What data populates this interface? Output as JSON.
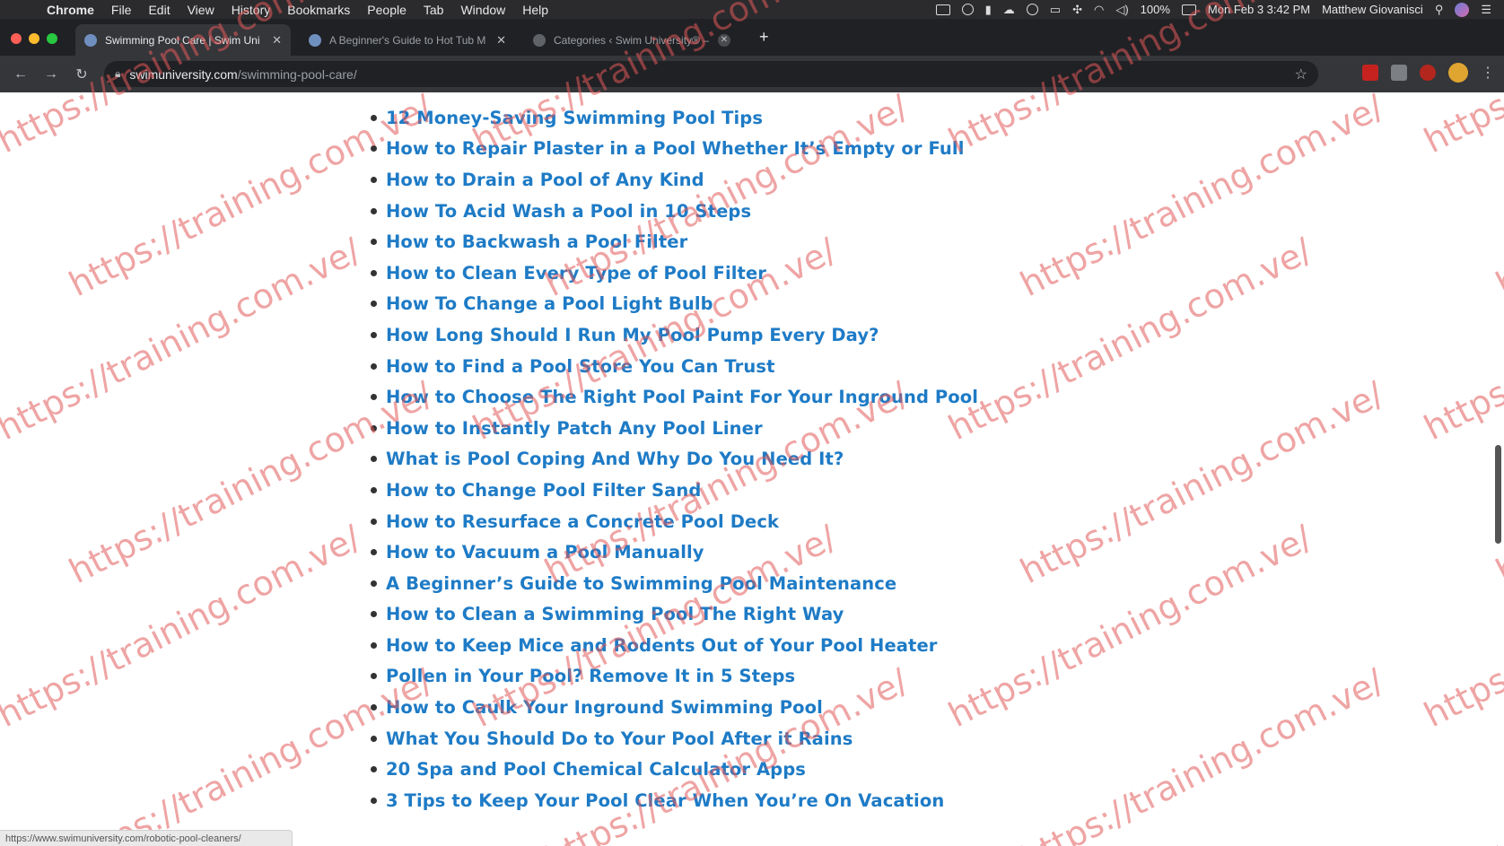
{
  "menubar": {
    "app": "Chrome",
    "items": [
      "File",
      "Edit",
      "View",
      "History",
      "Bookmarks",
      "People",
      "Tab",
      "Window",
      "Help"
    ],
    "battery": "100%",
    "clock": "Mon Feb 3  3:42 PM",
    "user": "Matthew Giovanisci"
  },
  "tabs": [
    {
      "title": "Swimming Pool Care | Swim Uni",
      "active": true
    },
    {
      "title": "A Beginner's Guide to Hot Tub M",
      "active": false
    },
    {
      "title": "Categories ‹ Swim University® –",
      "active": false
    }
  ],
  "toolbar": {
    "url_host": "swimuniversity.com",
    "url_path": "/swimming-pool-care/"
  },
  "articles": [
    "12 Money-Saving Swimming Pool Tips",
    "How to Repair Plaster in a Pool Whether It’s Empty or Full",
    "How to Drain a Pool of Any Kind",
    "How To Acid Wash a Pool in 10 Steps",
    "How to Backwash a Pool Filter",
    "How to Clean Every Type of Pool Filter",
    "How To Change a Pool Light Bulb",
    "How Long Should I Run My Pool Pump Every Day?",
    "How to Find a Pool Store You Can Trust",
    "How to Choose The Right Pool Paint For Your Inground Pool",
    "How to Instantly Patch Any Pool Liner",
    "What is Pool Coping And Why Do You Need It?",
    "How to Change Pool Filter Sand",
    "How to Resurface a Concrete Pool Deck",
    "How to Vacuum a Pool Manually",
    "A Beginner’s Guide to Swimming Pool Maintenance",
    "How to Clean a Swimming Pool The Right Way",
    "How to Keep Mice and Rodents Out of Your Pool Heater",
    "Pollen in Your Pool? Remove It in 5 Steps",
    "How to Caulk Your Inground Swimming Pool",
    "What You Should Do to Your Pool After it Rains",
    "20 Spa and Pool Chemical Calculator Apps",
    "3 Tips to Keep Your Pool Clear When You’re On Vacation"
  ],
  "watermark": "https://training.com.ve/",
  "status_url": "https://www.swimuniversity.com/robotic-pool-cleaners/",
  "colors": {
    "link": "#1e7bc6",
    "watermark": "#e25a5a"
  }
}
